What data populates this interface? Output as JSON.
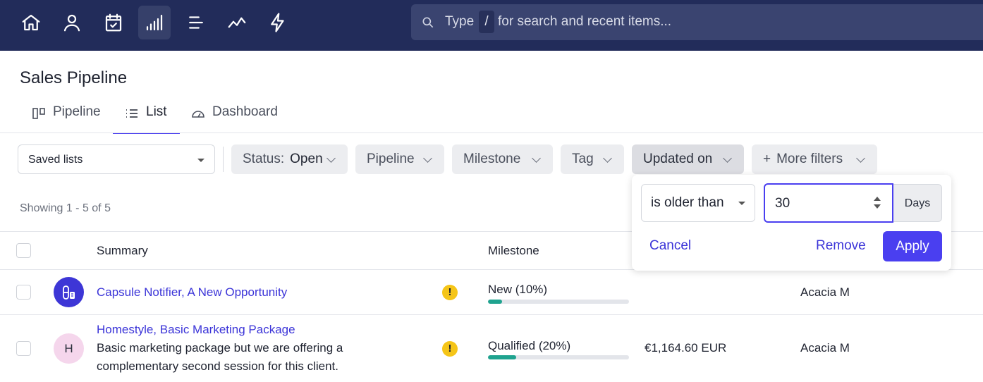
{
  "nav": {
    "icons": [
      "home-icon",
      "user-icon",
      "calendar-check-icon",
      "signal-bars-icon",
      "list-align-icon",
      "trend-line-icon",
      "lightning-icon"
    ],
    "active_index": 3
  },
  "search": {
    "prefix": "Type",
    "key": "/",
    "suffix": "for search and recent items..."
  },
  "page": {
    "title": "Sales Pipeline",
    "tabs": [
      {
        "label": "Pipeline",
        "icon": "board-icon"
      },
      {
        "label": "List",
        "icon": "list-icon",
        "active": true
      },
      {
        "label": "Dashboard",
        "icon": "gauge-icon"
      }
    ]
  },
  "filters": {
    "saved_lists": "Saved lists",
    "status_label": "Status:",
    "status_value": "Open",
    "pipeline": "Pipeline",
    "milestone": "Milestone",
    "tag": "Tag",
    "updated_on": "Updated on",
    "more_filters": "More filters",
    "more_prefix": "+"
  },
  "showing": "Showing 1 - 5 of 5",
  "table": {
    "headers": {
      "summary": "Summary",
      "milestone": "Milestone"
    },
    "rows": [
      {
        "avatar_initial": "",
        "title": "Capsule Notifier, A New Opportunity",
        "description": "",
        "milestone": "New (10%)",
        "progress": 0.1,
        "value": "",
        "owner": "Acacia M"
      },
      {
        "avatar_initial": "H",
        "title": "Homestyle, Basic Marketing Package",
        "description": "Basic marketing package but we are offering a complementary second session for this client.",
        "milestone": "Qualified (20%)",
        "progress": 0.2,
        "value": "€1,164.60 EUR",
        "owner": "Acacia M"
      }
    ]
  },
  "popover": {
    "operator": "is older than",
    "value": "30",
    "unit": "Days",
    "cancel": "Cancel",
    "remove": "Remove",
    "apply": "Apply"
  },
  "colors": {
    "topbar": "#222c5a",
    "accent": "#4a3ff0",
    "link": "#3b34d8",
    "progress": "#1fa38f",
    "warning": "#f5c518"
  }
}
